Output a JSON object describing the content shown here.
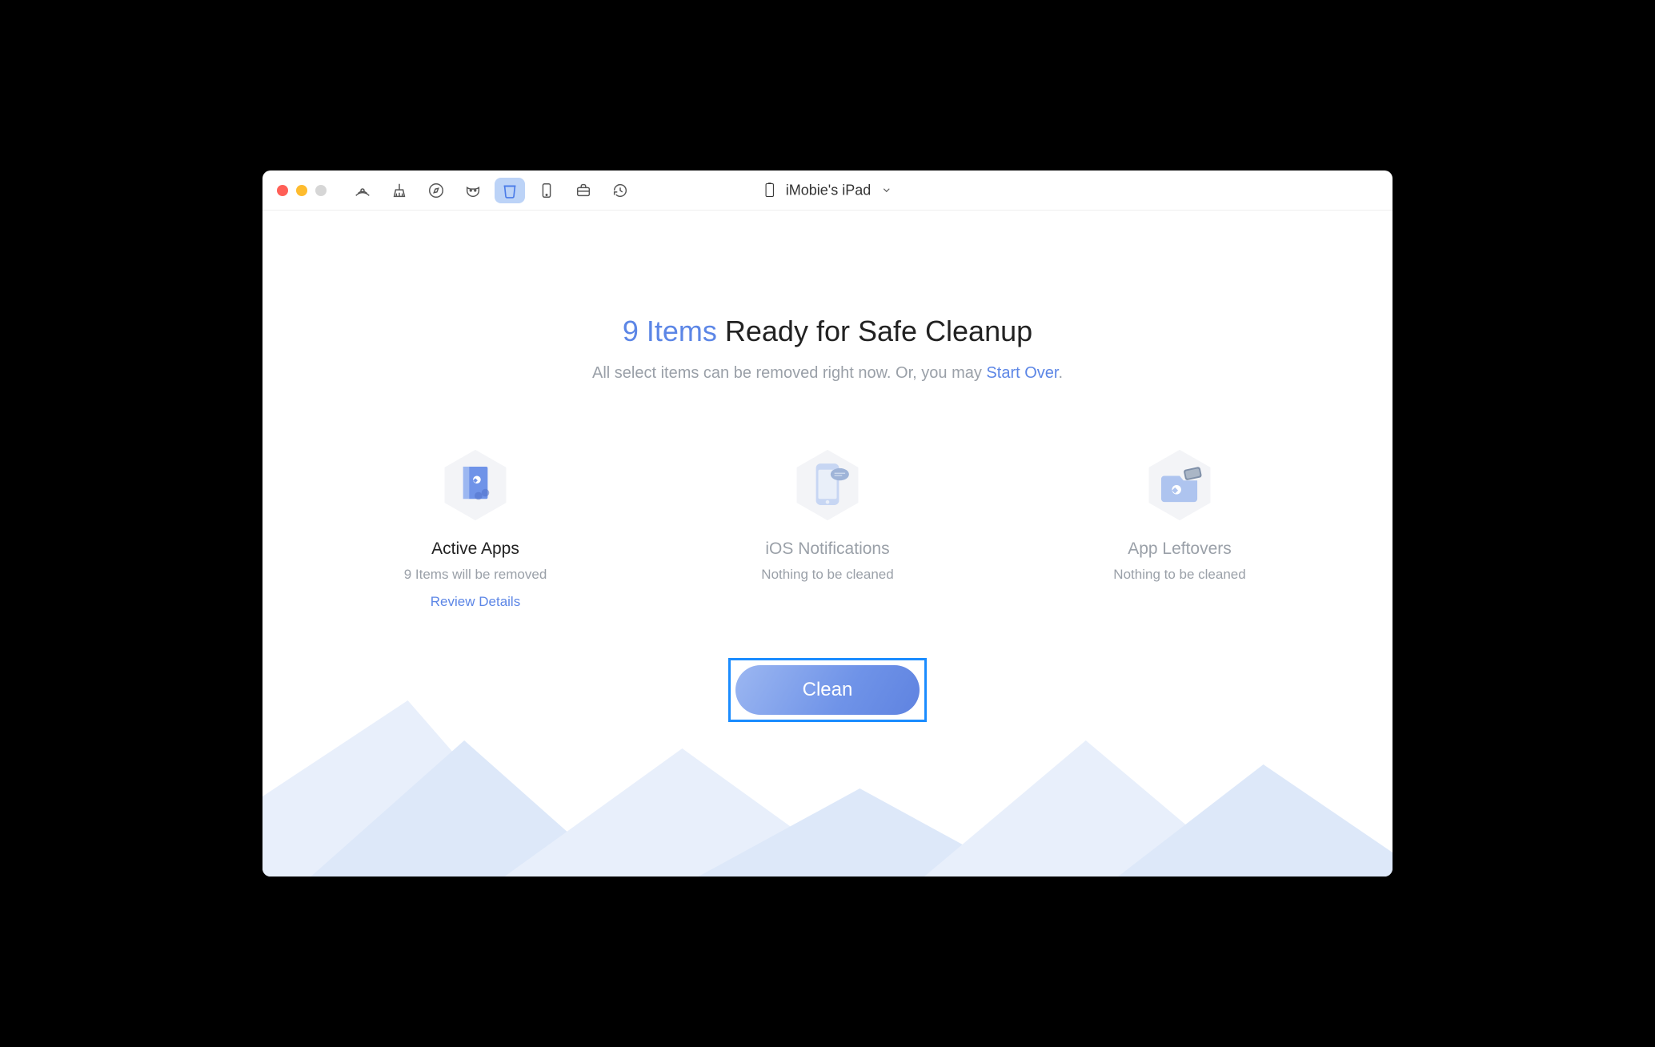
{
  "device": {
    "name": "iMobie's iPad"
  },
  "headline": {
    "accent": "9 Items",
    "rest": " Ready for Safe Cleanup"
  },
  "subline": {
    "before": "All select items can be removed right now. Or, you may ",
    "link": "Start Over",
    "after": "."
  },
  "cards": {
    "active_apps": {
      "title": "Active Apps",
      "sub": "9 Items will be removed",
      "link": "Review Details"
    },
    "ios_notifications": {
      "title": "iOS Notifications",
      "sub": "Nothing to be cleaned"
    },
    "app_leftovers": {
      "title": "App Leftovers",
      "sub": "Nothing to be cleaned"
    }
  },
  "clean_button_label": "Clean",
  "toolbar_icons": [
    "airdrop",
    "broom",
    "compass",
    "mask",
    "trash",
    "device",
    "briefcase",
    "history"
  ]
}
